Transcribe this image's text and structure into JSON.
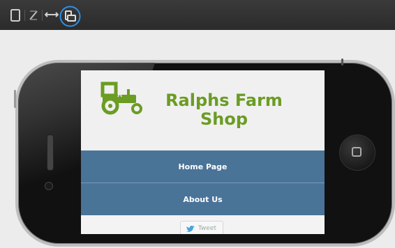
{
  "toolbar": {
    "buttons": [
      {
        "icon": "portrait-device-icon"
      },
      {
        "icon": "pen-icon"
      },
      {
        "icon": "resize-horizontal-icon"
      },
      {
        "icon": "rotate-device-icon"
      }
    ]
  },
  "site": {
    "title_line1": "Ralphs Farm",
    "title_line2": "Shop",
    "logo_icon": "tractor-icon",
    "brand_color": "#6b9c24",
    "nav": [
      {
        "label": "Home Page"
      },
      {
        "label": "About Us"
      }
    ],
    "tweet_label": "Tweet"
  }
}
